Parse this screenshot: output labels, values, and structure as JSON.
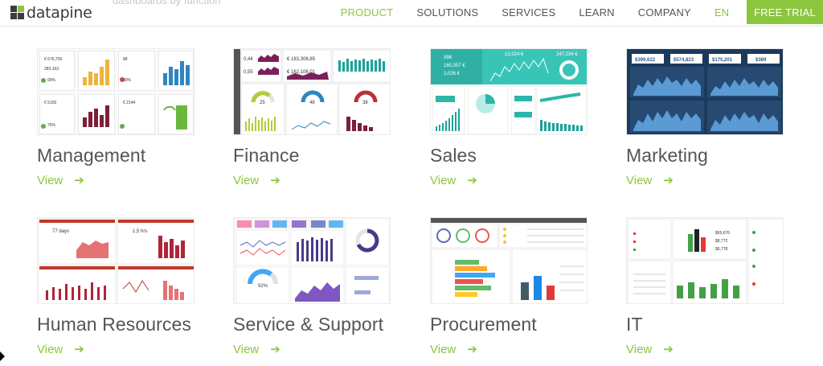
{
  "header": {
    "logo_text": "datapine",
    "faded_title": "dashboards by function",
    "nav": [
      "PRODUCT",
      "SOLUTIONS",
      "SERVICES",
      "LEARN",
      "COMPANY"
    ],
    "language": "EN",
    "cta": "FREE TRIAL"
  },
  "colors": {
    "brand_green": "#8cc63f",
    "text_dark": "#555555"
  },
  "cards": [
    {
      "title": "Management",
      "link": "View",
      "thumbnail": "management-dashboard"
    },
    {
      "title": "Finance",
      "link": "View",
      "thumbnail": "finance-dashboard"
    },
    {
      "title": "Sales",
      "link": "View",
      "thumbnail": "sales-dashboard"
    },
    {
      "title": "Marketing",
      "link": "View",
      "thumbnail": "marketing-dashboard"
    },
    {
      "title": "Human Resources",
      "link": "View",
      "thumbnail": "hr-dashboard"
    },
    {
      "title": "Service & Support",
      "link": "View",
      "thumbnail": "service-dashboard"
    },
    {
      "title": "Procurement",
      "link": "View",
      "thumbnail": "procurement-dashboard"
    },
    {
      "title": "IT",
      "link": "View",
      "thumbnail": "it-dashboard"
    }
  ],
  "arrow_icon": "arrow-right-icon"
}
